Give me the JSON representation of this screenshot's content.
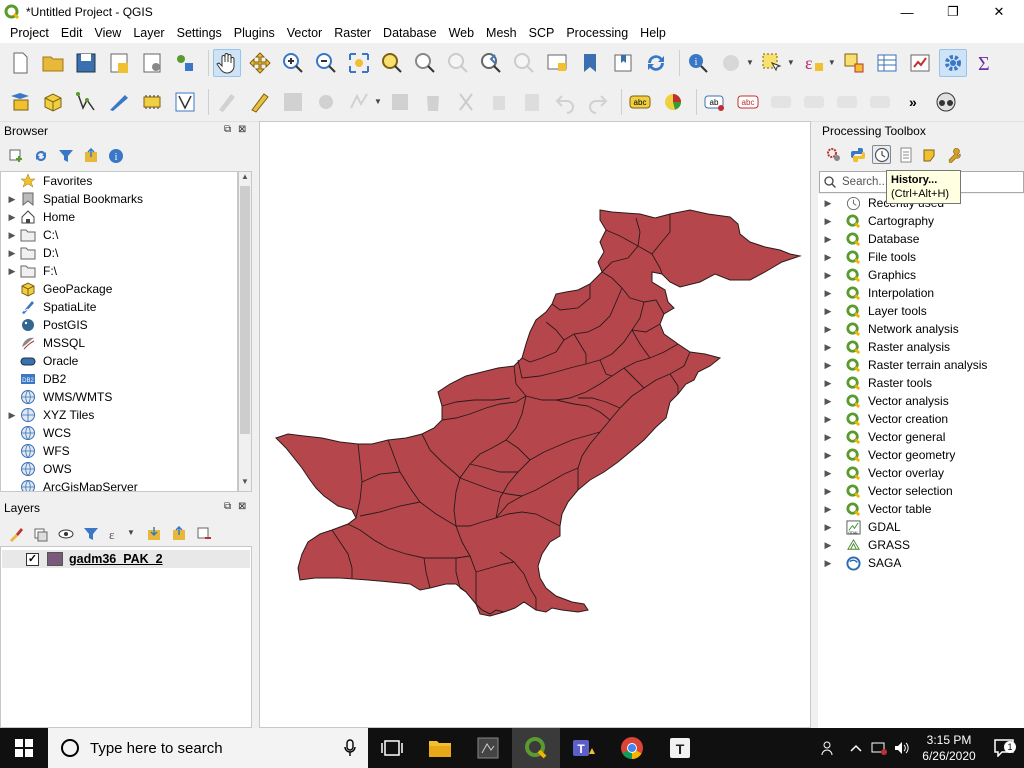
{
  "window": {
    "title": "*Untitled Project - QGIS",
    "minimize": "—",
    "maximize": "❐",
    "close": "✕"
  },
  "menu": [
    "Project",
    "Edit",
    "View",
    "Layer",
    "Settings",
    "Plugins",
    "Vector",
    "Raster",
    "Database",
    "Web",
    "Mesh",
    "SCP",
    "Processing",
    "Help"
  ],
  "browser": {
    "title": "Browser",
    "items": [
      {
        "label": "Favorites",
        "icon": "star-icon",
        "expand": false
      },
      {
        "label": "Spatial Bookmarks",
        "icon": "bookmark-icon",
        "expand": true
      },
      {
        "label": "Home",
        "icon": "home-icon",
        "expand": true
      },
      {
        "label": "C:\\",
        "icon": "folder-icon",
        "expand": true
      },
      {
        "label": "D:\\",
        "icon": "folder-icon",
        "expand": true
      },
      {
        "label": "F:\\",
        "icon": "folder-icon",
        "expand": true
      },
      {
        "label": "GeoPackage",
        "icon": "geopackage-icon",
        "expand": false
      },
      {
        "label": "SpatiaLite",
        "icon": "spatialite-icon",
        "expand": false
      },
      {
        "label": "PostGIS",
        "icon": "postgis-icon",
        "expand": false
      },
      {
        "label": "MSSQL",
        "icon": "mssql-icon",
        "expand": false
      },
      {
        "label": "Oracle",
        "icon": "oracle-icon",
        "expand": false
      },
      {
        "label": "DB2",
        "icon": "db2-icon",
        "expand": false
      },
      {
        "label": "WMS/WMTS",
        "icon": "globe-icon",
        "expand": false
      },
      {
        "label": "XYZ Tiles",
        "icon": "xyz-icon",
        "expand": true
      },
      {
        "label": "WCS",
        "icon": "globe-icon",
        "expand": false
      },
      {
        "label": "WFS",
        "icon": "globe-icon",
        "expand": false
      },
      {
        "label": "OWS",
        "icon": "globe-icon",
        "expand": false
      },
      {
        "label": "ArcGisMapServer",
        "icon": "globe-icon",
        "expand": false
      }
    ]
  },
  "layers": {
    "title": "Layers",
    "items": [
      {
        "name": "gadm36_PAK_2",
        "checked": "✓",
        "color": "#7a5a7a"
      }
    ]
  },
  "processing": {
    "title": "Processing Toolbox",
    "search_placeholder": "Search...",
    "tooltip_title": "History...",
    "tooltip_shortcut": "(Ctrl+Alt+H)",
    "items": [
      {
        "label": "Recently used",
        "icon": "clock-icon"
      },
      {
        "label": "Cartography",
        "icon": "qgis-icon"
      },
      {
        "label": "Database",
        "icon": "qgis-icon"
      },
      {
        "label": "File tools",
        "icon": "qgis-icon"
      },
      {
        "label": "Graphics",
        "icon": "qgis-icon"
      },
      {
        "label": "Interpolation",
        "icon": "qgis-icon"
      },
      {
        "label": "Layer tools",
        "icon": "qgis-icon"
      },
      {
        "label": "Network analysis",
        "icon": "qgis-icon"
      },
      {
        "label": "Raster analysis",
        "icon": "qgis-icon"
      },
      {
        "label": "Raster terrain analysis",
        "icon": "qgis-icon"
      },
      {
        "label": "Raster tools",
        "icon": "qgis-icon"
      },
      {
        "label": "Vector analysis",
        "icon": "qgis-icon"
      },
      {
        "label": "Vector creation",
        "icon": "qgis-icon"
      },
      {
        "label": "Vector general",
        "icon": "qgis-icon"
      },
      {
        "label": "Vector geometry",
        "icon": "qgis-icon"
      },
      {
        "label": "Vector overlay",
        "icon": "qgis-icon"
      },
      {
        "label": "Vector selection",
        "icon": "qgis-icon"
      },
      {
        "label": "Vector table",
        "icon": "qgis-icon"
      },
      {
        "label": "GDAL",
        "icon": "gdal-icon"
      },
      {
        "label": "GRASS",
        "icon": "grass-icon"
      },
      {
        "label": "SAGA",
        "icon": "saga-icon"
      }
    ]
  },
  "map": {
    "fill_color": "#b5474c",
    "stroke_color": "#2a1a1a"
  },
  "taskbar": {
    "search_text": "Type here to search",
    "time": "3:15 PM",
    "date": "6/26/2020",
    "notification_count": "1"
  },
  "colors": {
    "qgis_green": "#5a9a2e",
    "accent": "#3a77c6"
  }
}
